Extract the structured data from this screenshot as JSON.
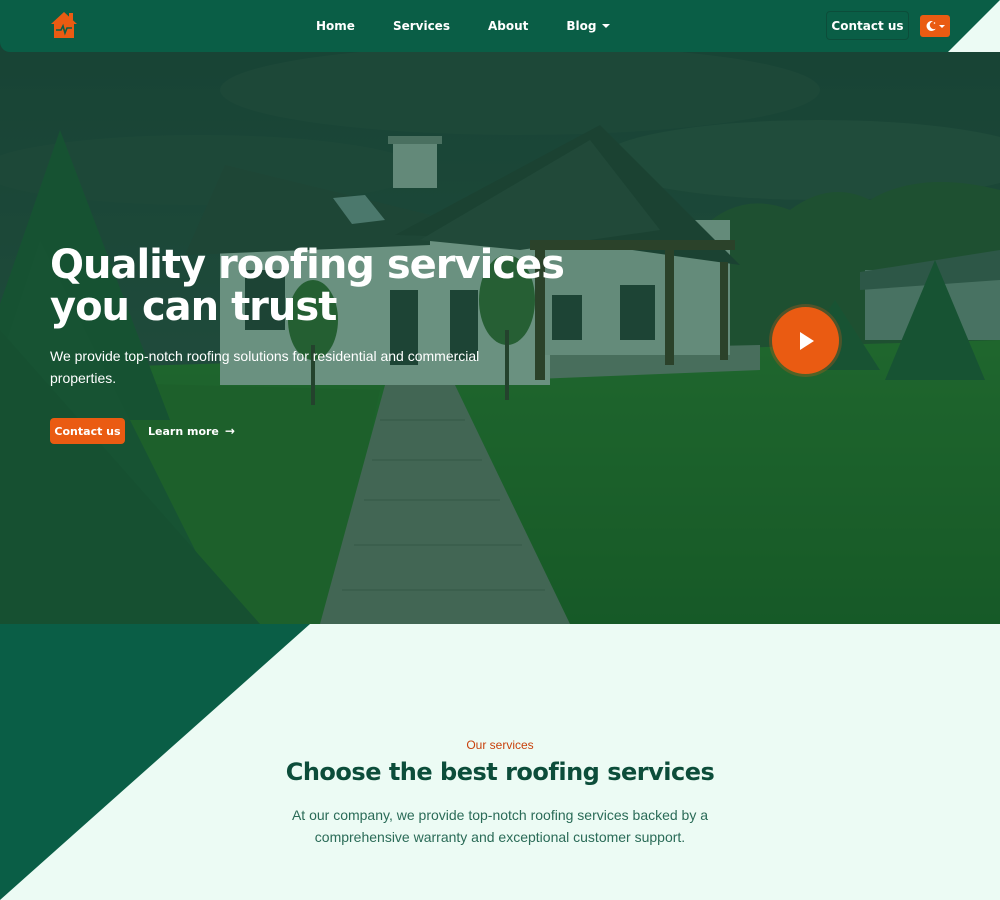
{
  "colors": {
    "primary_green": "#0a5e46",
    "accent_orange": "#ea5b12",
    "section_bg": "#ecfbf4",
    "heading_green": "#0c4d3a"
  },
  "header": {
    "logo_icon": "house-heartbeat-icon",
    "nav": {
      "home": "Home",
      "services": "Services",
      "about": "About",
      "blog": "Blog"
    },
    "contact_label": "Contact us",
    "theme_toggle_icon": "moon-icon"
  },
  "hero": {
    "title": "Quality roofing services you can trust",
    "subtitle": "We provide top-notch roofing solutions for residential and commercial properties.",
    "cta_label": "Contact us",
    "learn_label": "Learn more",
    "learn_icon": "arrow-right-icon",
    "play_icon": "play-icon"
  },
  "services": {
    "eyebrow": "Our services",
    "title": "Choose the best roofing services",
    "description": "At our company, we provide top-notch roofing services backed by a comprehensive warranty and exceptional customer support."
  }
}
